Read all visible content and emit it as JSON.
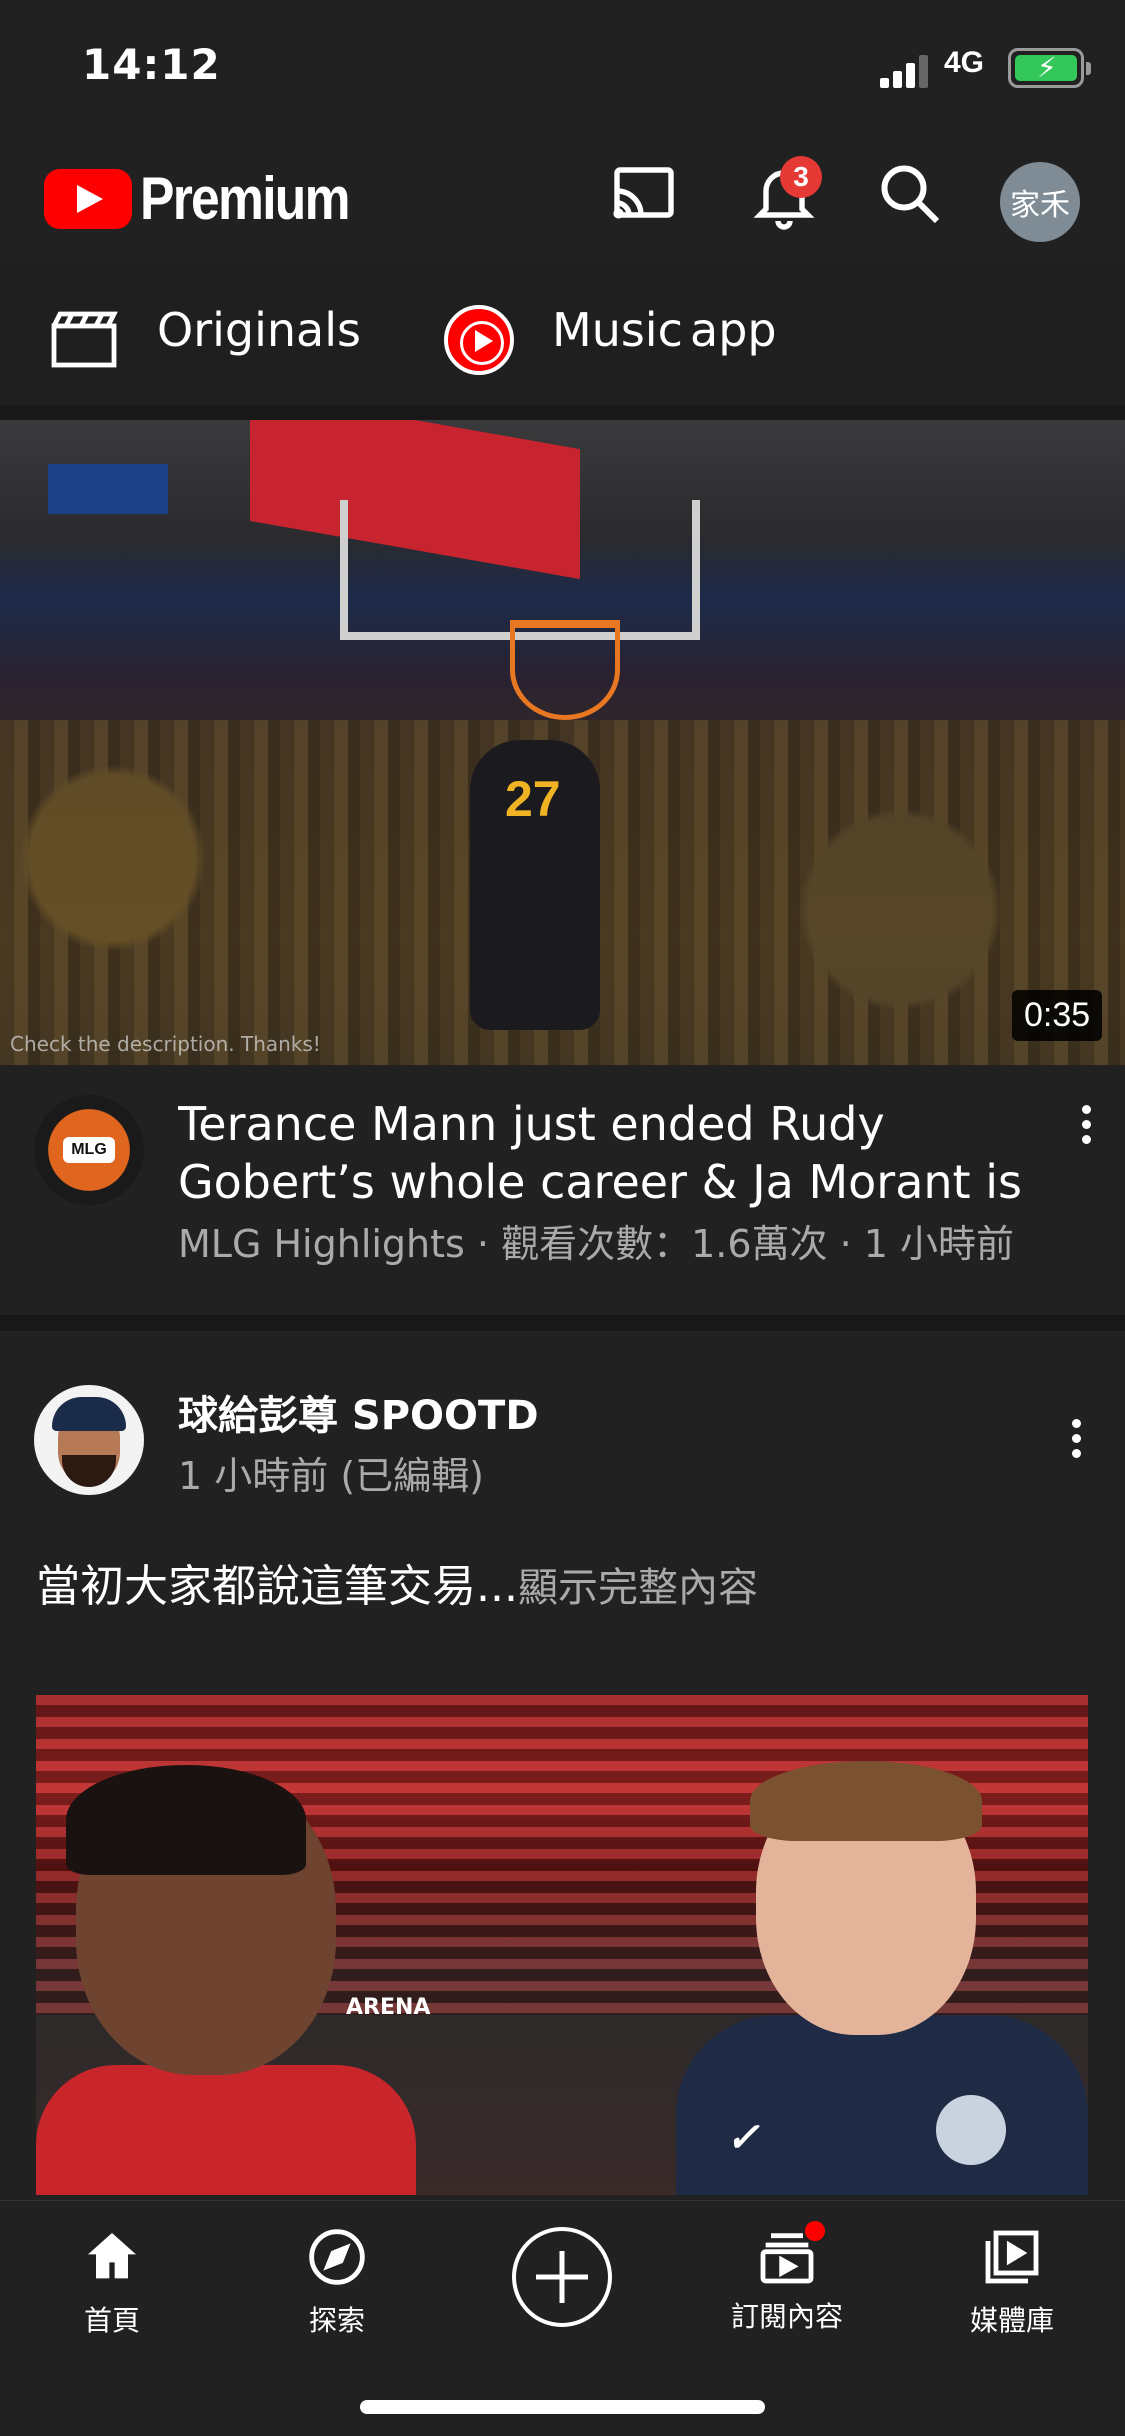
{
  "status_bar": {
    "time": "14:12",
    "network": "4G"
  },
  "header": {
    "brand": "Premium",
    "notification_count": "3",
    "account_initials": "家禾"
  },
  "promo": {
    "originals": "Originals",
    "music": "Music",
    "app": "app"
  },
  "video": {
    "duration": "0:35",
    "watermark": "Check the description. Thanks!",
    "title": "Terance Mann just ended Rudy Gobert’s whole career & Ja Morant is j...",
    "meta": "MLG Highlights · 觀看次數：1.6萬次 · 1 小時前",
    "channel_badge": "MLG"
  },
  "post": {
    "author": "球給彭尊 SPOOTD",
    "time": "1 小時前 (已編輯)",
    "text": "當初大家都說這筆交易...",
    "show_more": "顯示完整內容",
    "image_label": "ARENA"
  },
  "bottom_nav": {
    "home": "首頁",
    "explore": "探索",
    "subscriptions": "訂閱內容",
    "library": "媒體庫"
  },
  "colors": {
    "accent": "#ff0000",
    "badge": "#e53935",
    "battery": "#34c759"
  }
}
